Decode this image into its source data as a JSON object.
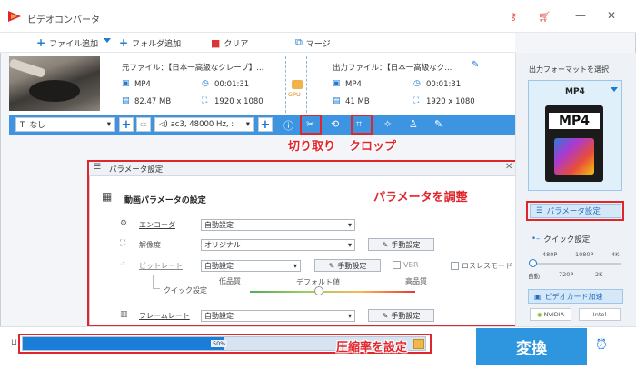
{
  "window": {
    "title": "ビデオコンバータ"
  },
  "toolbar": {
    "add_file": "ファイル追加",
    "add_folder": "フォルダ追加",
    "clear": "クリア",
    "merge": "マージ"
  },
  "item": {
    "source_file": "元ファイル：【日本一高級なクレープ】...",
    "source_format": "MP4",
    "source_duration": "00:01:31",
    "source_size": "82.47 MB",
    "source_resolution": "1920 x 1080",
    "output_file": "出力ファイル：【日本一高級なク...",
    "output_format": "MP4",
    "output_duration": "00:01:31",
    "output_size": "41 MB",
    "output_resolution": "1920 x 1080",
    "gpu_label": "GPU"
  },
  "editbar": {
    "subtitle_value": "なし",
    "audio_value": "ac3, 48000 Hz, :"
  },
  "annotations": {
    "cut": "切り取り",
    "crop": "クロップ",
    "adjust_params": "パラメータを調整",
    "compression": "圧縮率を設定"
  },
  "dialog": {
    "title": "パラメータ設定",
    "section_title": "動画パラメータの設定",
    "encoder_label": "エンコーダ",
    "encoder_value": "自動設定",
    "resolution_label": "解像度",
    "resolution_value": "オリジナル",
    "bitrate_label": "ビットレート",
    "bitrate_value": "自動設定",
    "vbr_label": "VBR",
    "lossless_label": "ロスレスモード",
    "quick_label": "クイック設定",
    "low_quality": "低品質",
    "default_value": "デフォルト値",
    "high_quality": "高品質",
    "framerate_label": "フレームレート",
    "framerate_value": "自動設定",
    "manual_label": "手動設定",
    "manual_label_2": "手動設定",
    "manual_label_3": "手動設定"
  },
  "right_panel": {
    "output_format_label": "出力フォーマットを選択",
    "format_value": "MP4",
    "card_text": "MP4",
    "param_button": "パラメータ設定",
    "quick_settings": "クイック設定",
    "res_top": [
      "480P",
      "1080P",
      "4K"
    ],
    "res_bottom": [
      "自動",
      "720P",
      "2K"
    ],
    "gpu_accel": "ビデオカード加速",
    "vendor_nvidia": "NVIDIA",
    "vendor_intel": "Intel"
  },
  "bottom": {
    "progress_label": "50%",
    "progress_fraction": 0.5,
    "convert_label": "変換"
  },
  "colors": {
    "accent": "#3d95e1",
    "annotation": "#e0262d"
  }
}
